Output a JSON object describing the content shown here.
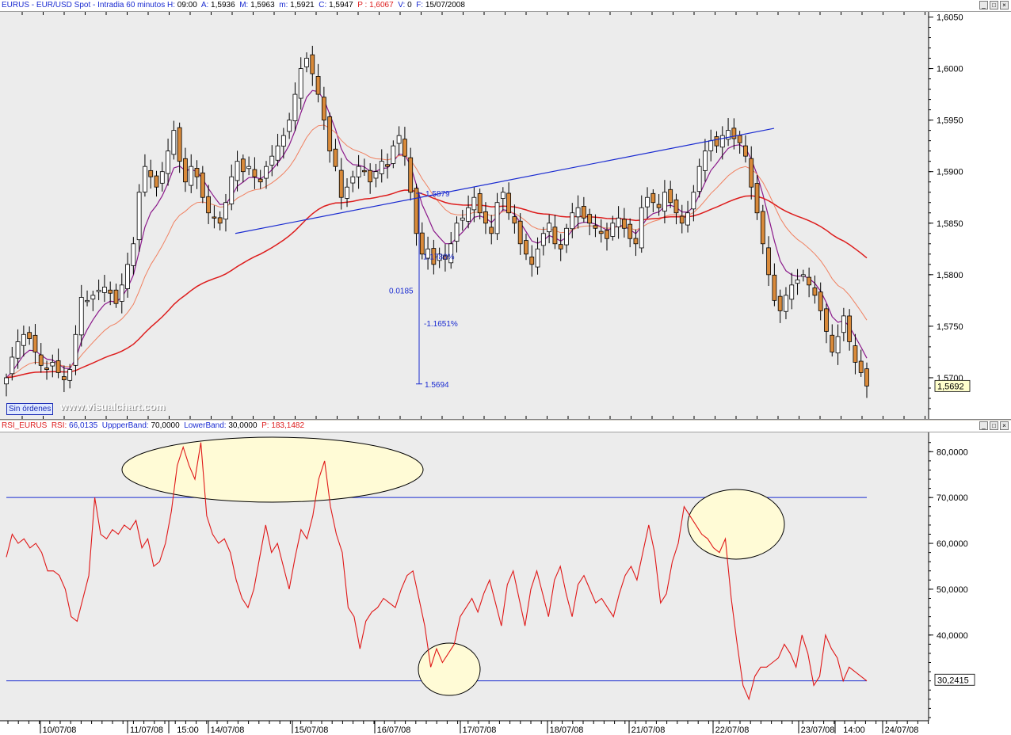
{
  "price_panel": {
    "header": {
      "symbol": "EURUS",
      "description": " - EUR/USD Spot - Intradia 60 minutos ",
      "h_label": "H:",
      "h_value": "09:00",
      "a_label": "A:",
      "a_value": "1,5936",
      "m_label": "M:",
      "m_value": "1,5963",
      "min_label": "m:",
      "min_value": "1,5921",
      "c_label": "C:",
      "c_value": "1,5947",
      "p_label": "P :",
      "p_value": "1,6067",
      "v_label": "V:",
      "v_value": "0",
      "f_label": "F:",
      "f_value": "15/07/2008"
    },
    "current_price_label": "1,5692",
    "sin_ordenes": "Sin órdenes",
    "watermark": "www.visualchart.com"
  },
  "rsi_panel": {
    "header": {
      "name": "RSI_EURUS",
      "rsi_label": "RSI:",
      "rsi_value": "66,0135",
      "upper_label": "UppperBand:",
      "upper_value": "70,0000",
      "lower_label": "LowerBand:",
      "lower_value": "30,0000",
      "p_label": "P:",
      "p_value": "183,1482"
    },
    "current_value_label": "30,2415"
  },
  "colors": {
    "candle_body": "#d98a3a",
    "candle_wick": "#000000",
    "ma_fast": "#8b1a8b",
    "ma_mid": "#f08060",
    "ma_slow": "#dd1c1c",
    "trendline": "#1a2bd1",
    "rsi_line": "#e01818",
    "band_line": "#1a2bd1",
    "ellipse_fill": "#fffbd6",
    "panel_bg": "#ececec"
  },
  "chart_data": [
    {
      "type": "candlestick",
      "title": "EURUS - EUR/USD Spot - Intradia 60 minutos",
      "y_ticks": [
        "1,6050",
        "1,6000",
        "1,5950",
        "1,5900",
        "1,5850",
        "1,5800",
        "1,5750",
        "1,5700"
      ],
      "ylim": [
        1.566,
        1.6055
      ],
      "x_ticks": [
        "10/07/08",
        "11/07/08",
        "15:00",
        "14/07/08",
        "15/07/08",
        "16/07/08",
        "17/07/08",
        "18/07/08",
        "21/07/08",
        "22/07/08",
        "23/07/08",
        "14:00",
        "24/07/08"
      ],
      "close_series": [
        1.57,
        1.572,
        1.5735,
        1.5742,
        1.5738,
        1.5725,
        1.5712,
        1.5708,
        1.5715,
        1.5705,
        1.5698,
        1.5708,
        1.5742,
        1.5778,
        1.5775,
        1.578,
        1.5785,
        1.5788,
        1.5782,
        1.5772,
        1.579,
        1.581,
        1.583,
        1.588,
        1.5905,
        1.5895,
        1.5885,
        1.59,
        1.592,
        1.594,
        1.591,
        1.589,
        1.5905,
        1.5895,
        1.5875,
        1.586,
        1.5855,
        1.585,
        1.587,
        1.5895,
        1.591,
        1.59,
        1.5905,
        1.5895,
        1.589,
        1.5905,
        1.5915,
        1.5925,
        1.5935,
        1.595,
        1.5975,
        1.6,
        1.601,
        1.5995,
        1.5975,
        1.595,
        1.592,
        1.5905,
        1.5875,
        1.5885,
        1.5895,
        1.5905,
        1.59,
        1.589,
        1.59,
        1.591,
        1.5905,
        1.5925,
        1.5935,
        1.5915,
        1.588,
        1.584,
        1.582,
        1.5825,
        1.581,
        1.582,
        1.5815,
        1.583,
        1.585,
        1.5855,
        1.5865,
        1.5875,
        1.586,
        1.585,
        1.584,
        1.587,
        1.588,
        1.586,
        1.585,
        1.583,
        1.582,
        1.581,
        1.5825,
        1.584,
        1.585,
        1.583,
        1.5825,
        1.5845,
        1.586,
        1.5865,
        1.5855,
        1.585,
        1.5845,
        1.584,
        1.5835,
        1.585,
        1.5855,
        1.5845,
        1.5835,
        1.583,
        1.5865,
        1.5875,
        1.587,
        1.5865,
        1.588,
        1.587,
        1.586,
        1.585,
        1.586,
        1.588,
        1.5905,
        1.592,
        1.593,
        1.5925,
        1.5935,
        1.594,
        1.5932,
        1.5928,
        1.5915,
        1.5885,
        1.586,
        1.583,
        1.58,
        1.5775,
        1.5765,
        1.578,
        1.579,
        1.5795,
        1.58,
        1.579,
        1.578,
        1.5765,
        1.5745,
        1.5725,
        1.574,
        1.576,
        1.5735,
        1.5715,
        1.5705,
        1.5692
      ],
      "moving_averages": [
        "fast",
        "mid",
        "slow"
      ],
      "annotations": [
        {
          "label": "1.5879"
        },
        {
          "label": "1.1788%"
        },
        {
          "label": "0.0185"
        },
        {
          "label": "-1.1651%"
        },
        {
          "label": "1.5694"
        }
      ],
      "trendline_from": 1.584,
      "trendline_to": 1.5942
    },
    {
      "type": "line",
      "title": "RSI_EURUS",
      "y_ticks": [
        "80,0000",
        "70,0000",
        "60,0000",
        "50,0000",
        "40,0000"
      ],
      "ylim": [
        21.3,
        84.2
      ],
      "upper_band": 70,
      "lower_band": 30,
      "rsi_series": [
        57,
        62,
        60,
        61,
        59,
        60,
        58,
        54,
        54,
        53,
        50,
        44,
        43,
        48,
        53,
        70,
        62,
        61,
        63,
        62,
        64,
        63,
        65,
        59,
        61,
        55,
        56,
        60,
        67,
        77,
        81,
        77,
        74,
        82,
        66,
        62,
        60,
        61,
        58,
        52,
        48,
        46,
        50,
        57,
        64,
        58,
        60,
        55,
        50,
        57,
        63,
        61,
        66,
        74,
        78,
        68,
        62,
        58,
        46,
        44,
        37,
        43,
        45,
        46,
        48,
        47,
        46,
        50,
        53,
        54,
        48,
        42,
        33,
        37,
        34,
        36,
        38,
        44,
        46,
        48,
        45,
        49,
        52,
        47,
        42,
        51,
        54,
        48,
        42,
        50,
        54,
        49,
        44,
        52,
        55,
        49,
        44,
        51,
        53,
        50,
        47,
        48,
        46,
        44,
        49,
        53,
        55,
        52,
        58,
        64,
        58,
        47,
        49,
        56,
        60,
        68,
        66,
        64,
        62,
        61,
        59,
        58,
        61,
        48,
        38,
        29,
        26,
        31,
        33,
        33,
        34,
        35,
        38,
        36,
        33,
        40,
        36,
        29,
        31,
        40,
        37,
        35,
        30,
        33,
        32,
        31,
        30
      ]
    }
  ]
}
